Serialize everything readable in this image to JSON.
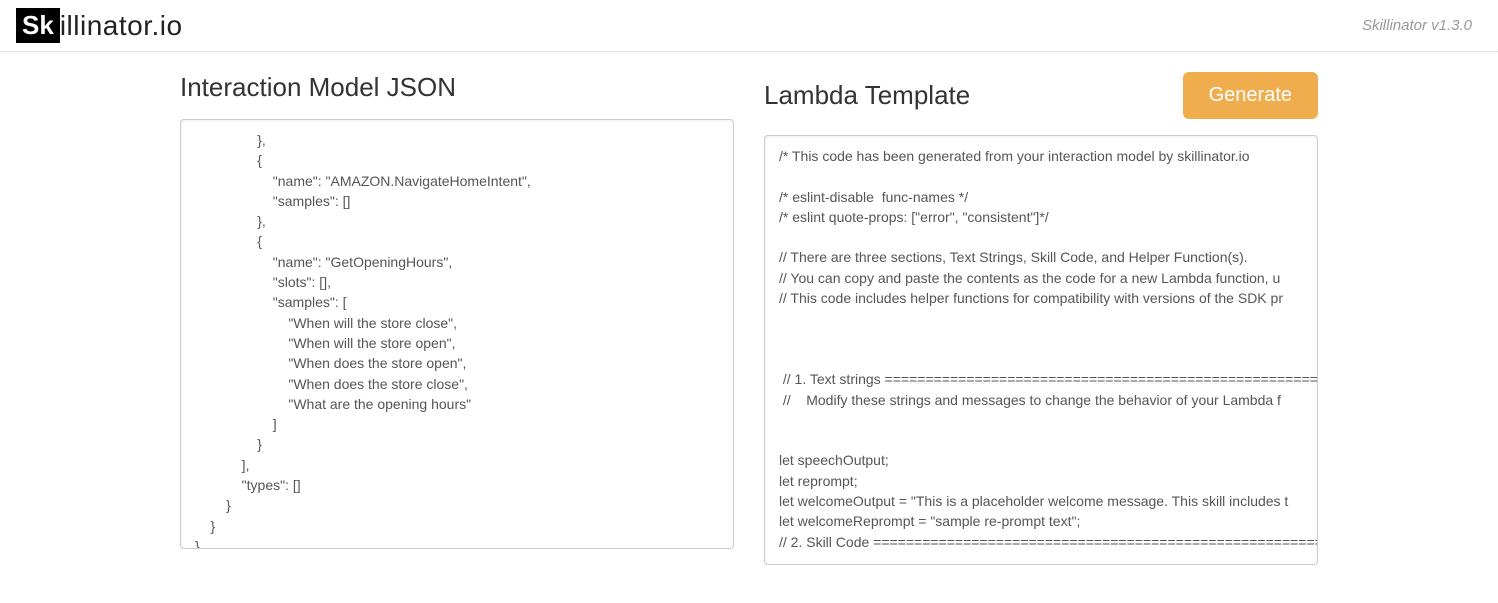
{
  "header": {
    "logo_mark": "Sk",
    "logo_text": "illinator.io",
    "version": "Skillinator v1.3.0"
  },
  "left": {
    "heading": "Interaction Model JSON",
    "content": "                },\n                {\n                    \"name\": \"AMAZON.NavigateHomeIntent\",\n                    \"samples\": []\n                },\n                {\n                    \"name\": \"GetOpeningHours\",\n                    \"slots\": [],\n                    \"samples\": [\n                        \"When will the store close\",\n                        \"When will the store open\",\n                        \"When does the store open\",\n                        \"When does the store close\",\n                        \"What are the opening hours\"\n                    ]\n                }\n            ],\n            \"types\": []\n        }\n    }\n}"
  },
  "right": {
    "heading": "Lambda Template",
    "button_label": "Generate",
    "content": "/* This code has been generated from your interaction model by skillinator.io\n\n/* eslint-disable  func-names */\n/* eslint quote-props: [\"error\", \"consistent\"]*/\n\n// There are three sections, Text Strings, Skill Code, and Helper Function(s).\n// You can copy and paste the contents as the code for a new Lambda function, u\n// This code includes helper functions for compatibility with versions of the SDK pr\n\n\n\n // 1. Text strings =====================================================================\n //    Modify these strings and messages to change the behavior of your Lambda f\n\n\nlet speechOutput;\nlet reprompt;\nlet welcomeOutput = \"This is a placeholder welcome message. This skill includes t\nlet welcomeReprompt = \"sample re-prompt text\";\n// 2. Skill Code ======================================================================="
  }
}
